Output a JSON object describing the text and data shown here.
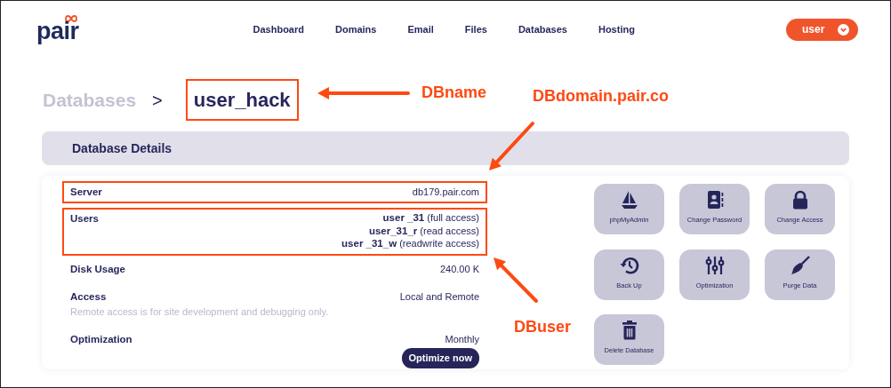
{
  "logo": {
    "text": "pair"
  },
  "nav": [
    {
      "label": "Dashboard"
    },
    {
      "label": "Domains"
    },
    {
      "label": "Email"
    },
    {
      "label": "Files"
    },
    {
      "label": "Databases"
    },
    {
      "label": "Hosting"
    }
  ],
  "user_menu": {
    "label": "user"
  },
  "breadcrumb": {
    "parent": "Databases",
    "separator": ">",
    "current": "user_hack",
    "current_highlighted": true
  },
  "section_title": "Database Details",
  "details": [
    {
      "kind": "value",
      "label": "Server",
      "value": "db179.pair.com",
      "highlighted": true
    },
    {
      "kind": "users",
      "label": "Users",
      "highlighted": true,
      "users": [
        {
          "name": "user _31",
          "access": "(full access)"
        },
        {
          "name": "user_31_r",
          "access": "(read access)"
        },
        {
          "name": "user _31_w",
          "access": "(readwrite access)"
        }
      ]
    },
    {
      "kind": "value",
      "label": "Disk Usage",
      "value": "240.00 K",
      "highlighted": false
    },
    {
      "kind": "value",
      "label": "Access",
      "value": "Local and Remote",
      "note": "Remote access is for site development and debugging only.",
      "highlighted": false
    },
    {
      "kind": "action",
      "label": "Optimization",
      "value": "Monthly",
      "button": "Optimize now",
      "highlighted": false
    }
  ],
  "actions": [
    {
      "label": "phpMyAdmin",
      "kind": "boat"
    },
    {
      "label": "Change Password",
      "kind": "contact"
    },
    {
      "label": "Change Access",
      "kind": "lock"
    },
    {
      "label": "Back Up",
      "kind": "history"
    },
    {
      "label": "Optimization",
      "kind": "sliders"
    },
    {
      "label": "Purge Data",
      "kind": "broom"
    },
    {
      "label": "Delete Database",
      "kind": "trash"
    }
  ],
  "annotations": [
    {
      "text": "DBname"
    },
    {
      "text": "DBdomain.pair.co"
    },
    {
      "text": "DBuser"
    }
  ]
}
